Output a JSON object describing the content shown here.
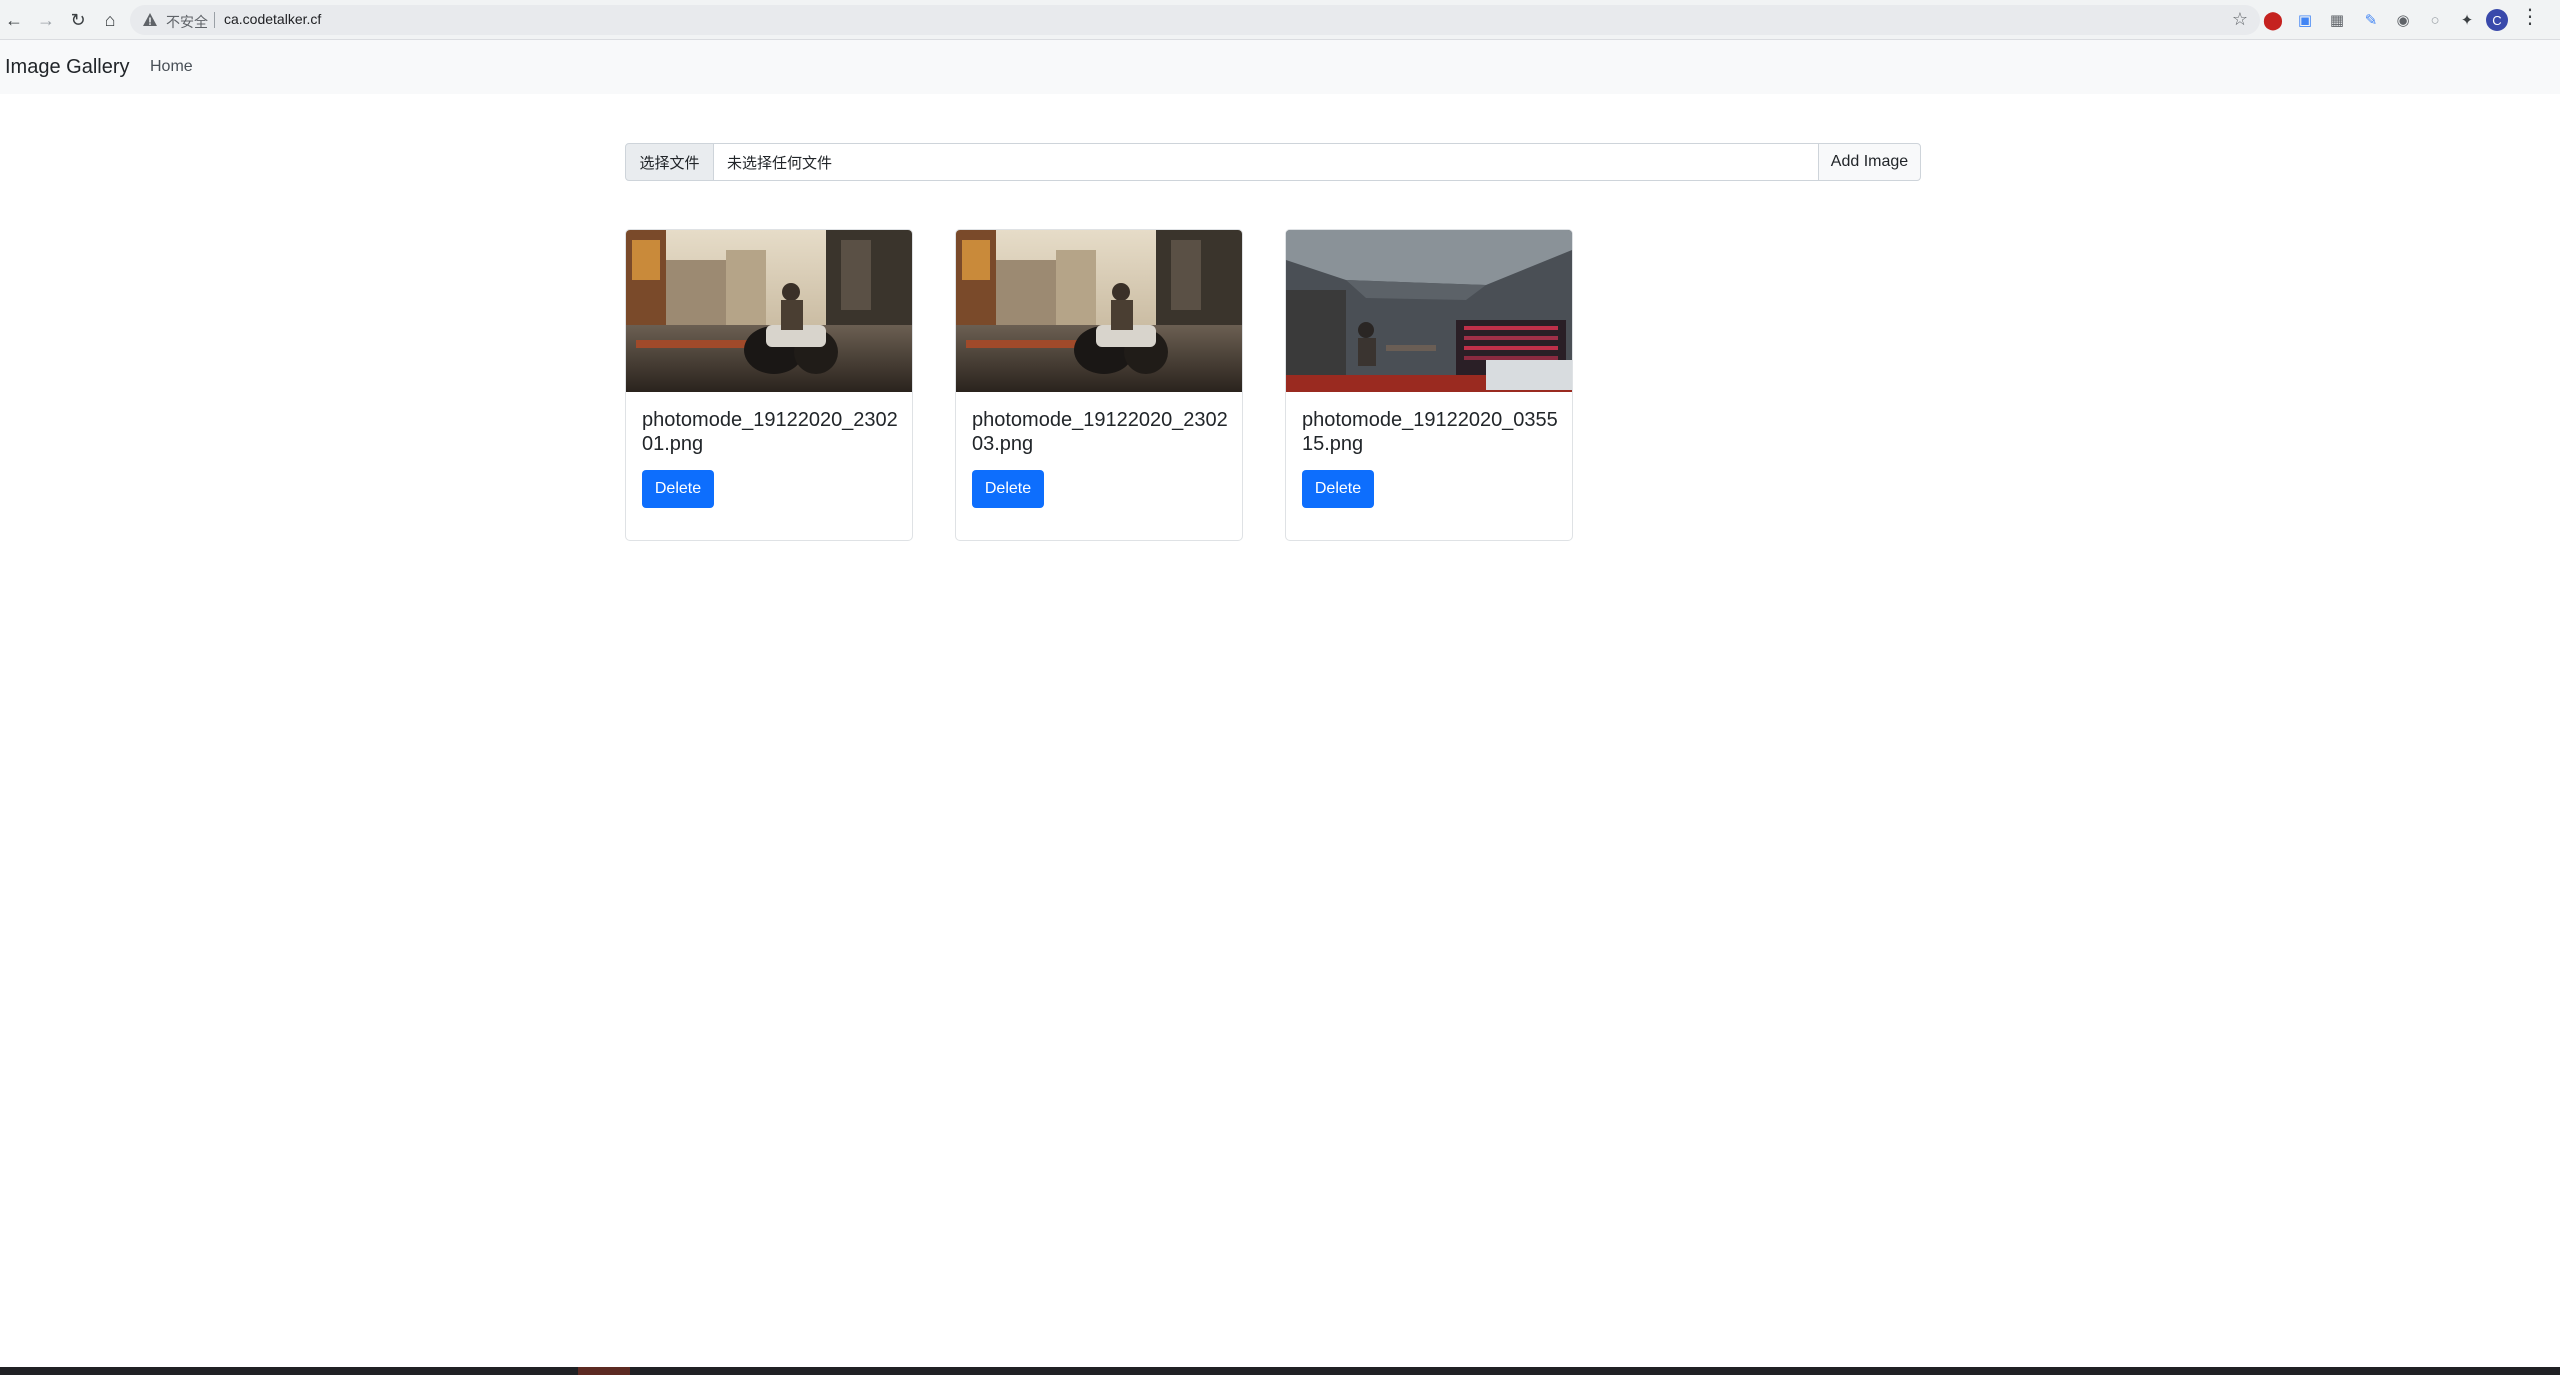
{
  "browser": {
    "security_label": "不安全",
    "url": "ca.codetalker.cf",
    "avatar_initial": "C",
    "icons": [
      "back-icon",
      "forward-icon",
      "reload-icon",
      "home-icon",
      "warning-icon",
      "star-icon",
      "extension-icons",
      "profile-avatar",
      "menu-icon"
    ]
  },
  "navbar": {
    "brand": "Image Gallery",
    "home_link": "Home"
  },
  "upload": {
    "choose_file_label": "选择文件",
    "no_file_text": "未选择任何文件",
    "add_button_label": "Add Image"
  },
  "gallery": {
    "cards": [
      {
        "filename": "photomode_19122020_230201.png",
        "delete_label": "Delete",
        "image": "motorcycle-street-screenshot"
      },
      {
        "filename": "photomode_19122020_230203.png",
        "delete_label": "Delete",
        "image": "motorcycle-street-screenshot"
      },
      {
        "filename": "photomode_19122020_035515.png",
        "delete_label": "Delete",
        "image": "restaurant-interior-screenshot"
      }
    ]
  },
  "colors": {
    "primary_button": "#0d6efd",
    "navbar_bg": "#f8f9fa",
    "chrome_bg": "#f1f3f4"
  }
}
